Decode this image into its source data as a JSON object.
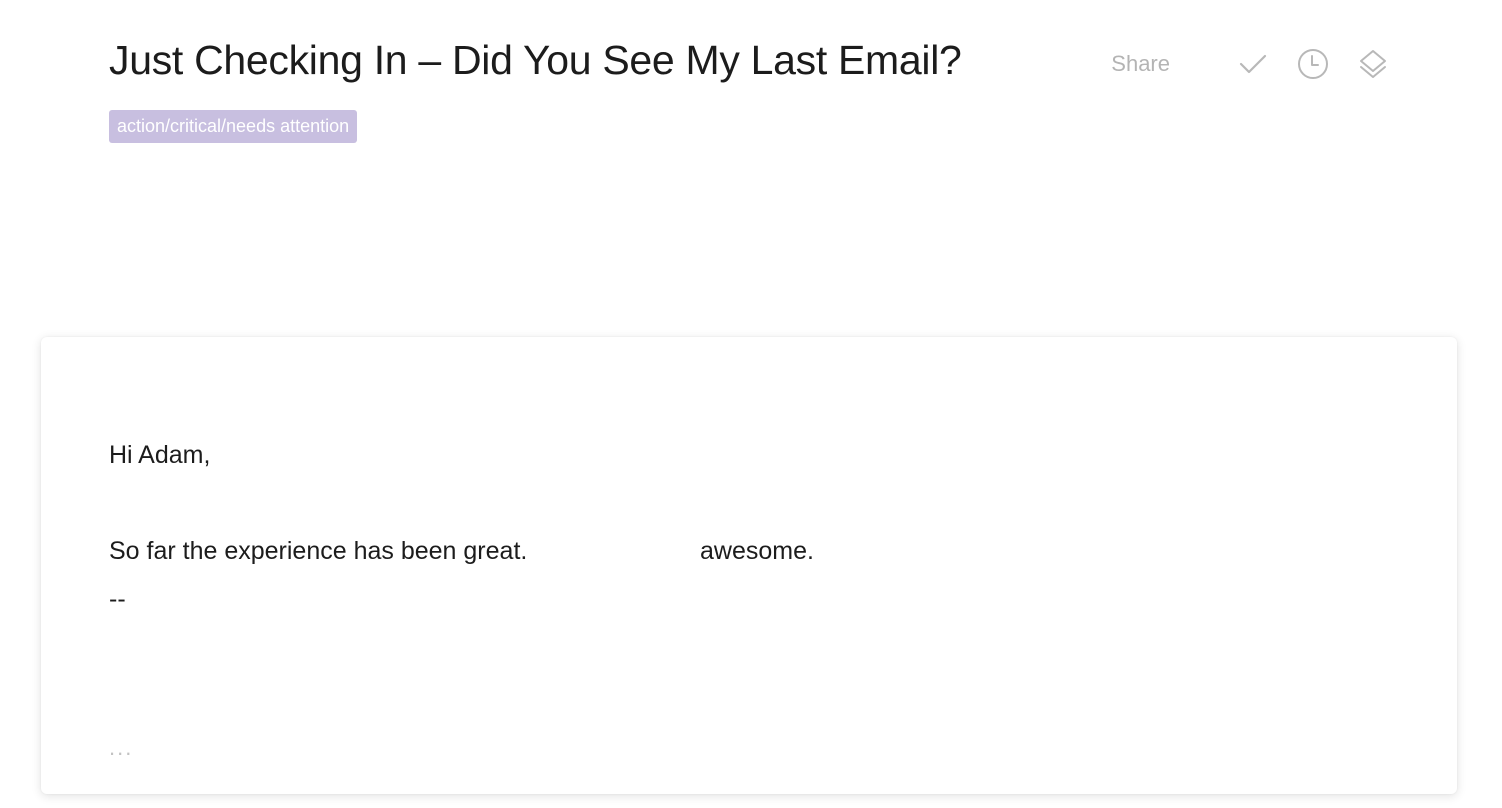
{
  "email": {
    "subject": "Just Checking In – Did You See My Last Email?",
    "label": "action/critical/needs attention",
    "label_color": "#c8bfe0"
  },
  "toolbar": {
    "share_label": "Share",
    "icons": [
      "check-icon",
      "clock-icon",
      "layers-icon"
    ],
    "icon_color": "#b8b8b8"
  },
  "message": {
    "greeting": "Hi Adam,",
    "line_part1": "So far the experience has been great.",
    "line_part2": "awesome.",
    "signature_separator": "--",
    "expand_indicator": "..."
  }
}
